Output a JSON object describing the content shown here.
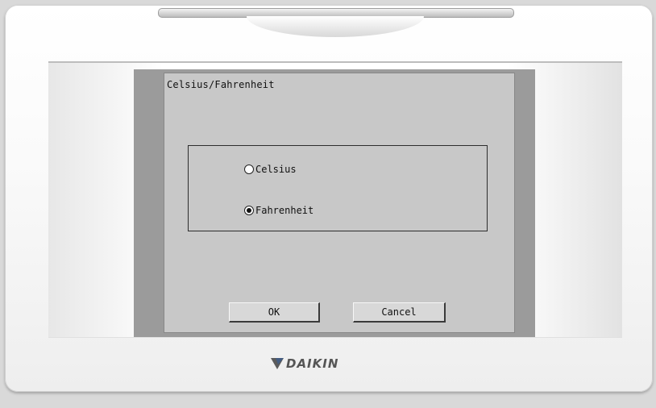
{
  "dialog": {
    "title": "Celsius/Fahrenheit",
    "options": [
      {
        "label": "Celsius",
        "selected": false
      },
      {
        "label": "Fahrenheit",
        "selected": true
      }
    ],
    "ok_label": "OK",
    "cancel_label": "Cancel"
  },
  "brand": {
    "name": "DAIKIN",
    "logo_icon": "daikin-triangle-icon"
  },
  "colors": {
    "screen": "#c8c8c8",
    "lcd_frame": "#9b9b9b",
    "text": "#111111"
  }
}
